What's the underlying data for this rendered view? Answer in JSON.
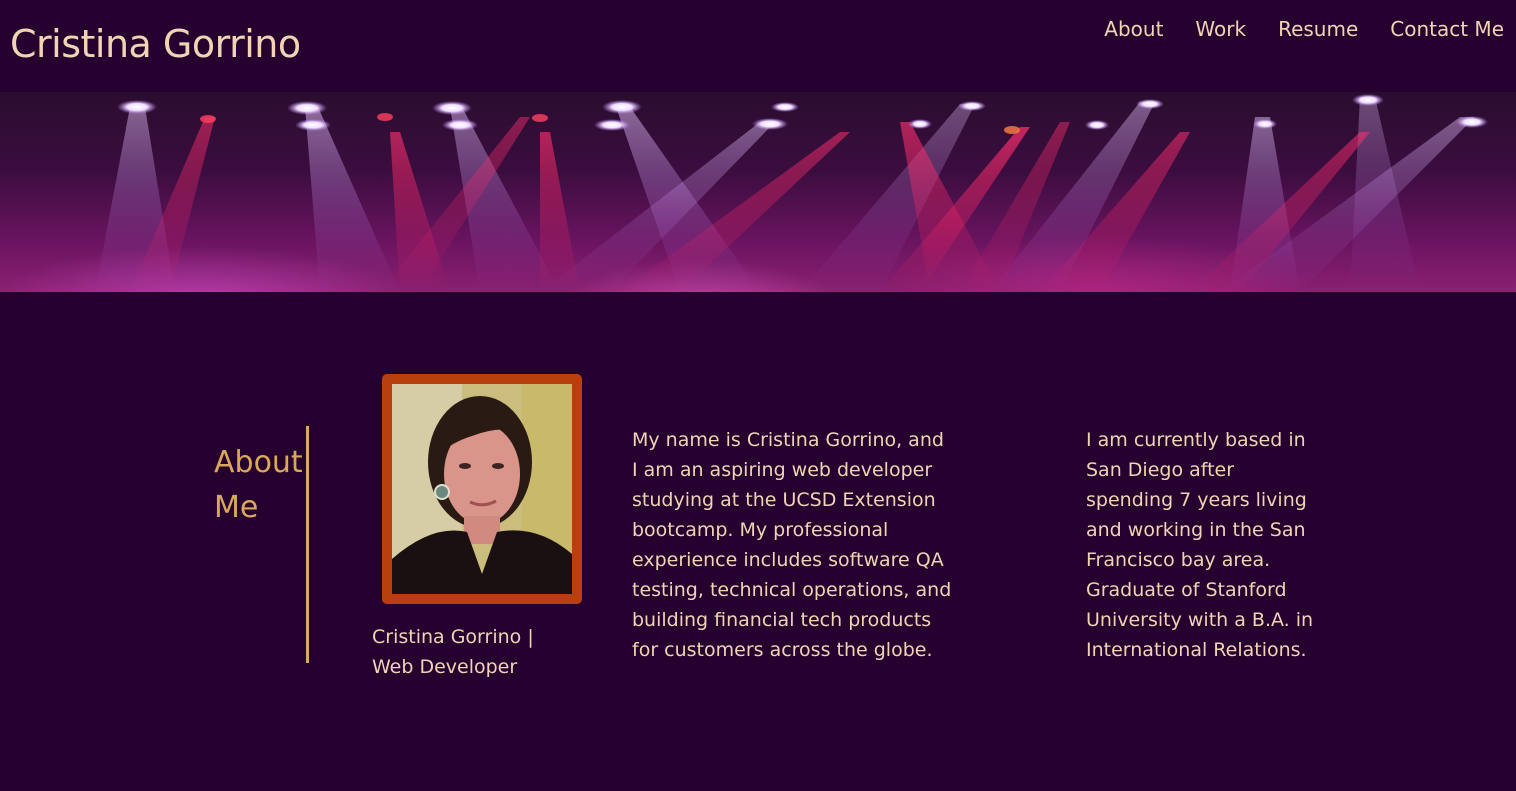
{
  "header": {
    "site_title": "Cristina Gorrino",
    "nav": [
      "About",
      "Work",
      "Resume",
      "Contact Me"
    ]
  },
  "about": {
    "heading": "About Me",
    "caption": "Cristina Gorrino | Web Developer",
    "bio_left": "My name is Cristina Gorrino, and I am an aspiring web developer studying at the UCSD Extension bootcamp. My professional experience includes software QA testing, technical operations, and building financial tech products for customers across the globe.",
    "bio_right": "I am currently based in San Diego after spending 7 years living and working in the San Francisco bay area. Graduate of Stanford University with a B.A. in International Relations."
  },
  "colors": {
    "background": "#26002f",
    "text": "#f0d4b4",
    "accent": "#d9a85a",
    "frame": "#b8400f"
  },
  "icons": {
    "hero": "stage-lights-image",
    "portrait": "profile-photo"
  }
}
